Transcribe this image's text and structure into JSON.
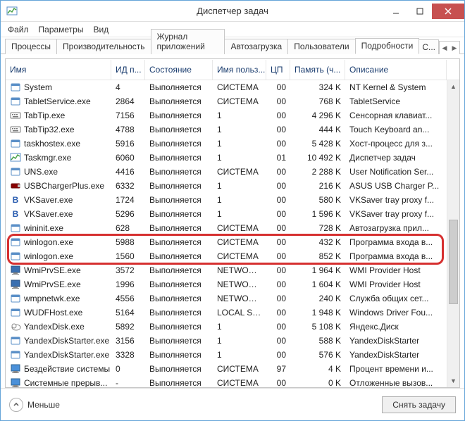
{
  "window": {
    "title": "Диспетчер задач"
  },
  "menu": {
    "file": "Файл",
    "options": "Параметры",
    "view": "Вид"
  },
  "tabs": {
    "items": [
      {
        "label": "Процессы"
      },
      {
        "label": "Производительность"
      },
      {
        "label": "Журнал приложений"
      },
      {
        "label": "Автозагрузка"
      },
      {
        "label": "Пользователи"
      },
      {
        "label": "Подробности"
      },
      {
        "label": "С..."
      }
    ],
    "activeIndex": 5
  },
  "columns": {
    "name": "Имя",
    "pid": "ИД п...",
    "state": "Состояние",
    "user": "Имя польз...",
    "cpu": "ЦП",
    "mem": "Память (ч...",
    "desc": "Описание"
  },
  "rows": [
    {
      "icon": "app",
      "name": "System",
      "pid": "4",
      "state": "Выполняется",
      "user": "СИСТЕМА",
      "cpu": "00",
      "mem": "324 K",
      "desc": "NT Kernel & System"
    },
    {
      "icon": "app",
      "name": "TabletService.exe",
      "pid": "2864",
      "state": "Выполняется",
      "user": "СИСТЕМА",
      "cpu": "00",
      "mem": "768 K",
      "desc": "TabletService"
    },
    {
      "icon": "kbd",
      "name": "TabTip.exe",
      "pid": "7156",
      "state": "Выполняется",
      "user": "1",
      "cpu": "00",
      "mem": "4 296 K",
      "desc": "Сенсорная клавиат..."
    },
    {
      "icon": "kbd",
      "name": "TabTip32.exe",
      "pid": "4788",
      "state": "Выполняется",
      "user": "1",
      "cpu": "00",
      "mem": "444 K",
      "desc": "Touch Keyboard an..."
    },
    {
      "icon": "app",
      "name": "taskhostex.exe",
      "pid": "5916",
      "state": "Выполняется",
      "user": "1",
      "cpu": "00",
      "mem": "5 428 K",
      "desc": "Хост-процесс для з..."
    },
    {
      "icon": "tm",
      "name": "Taskmgr.exe",
      "pid": "6060",
      "state": "Выполняется",
      "user": "1",
      "cpu": "01",
      "mem": "10 492 K",
      "desc": "Диспетчер задач"
    },
    {
      "icon": "app",
      "name": "UNS.exe",
      "pid": "4416",
      "state": "Выполняется",
      "user": "СИСТЕМА",
      "cpu": "00",
      "mem": "2 288 K",
      "desc": "User Notification Ser..."
    },
    {
      "icon": "usb",
      "name": "USBChargerPlus.exe",
      "pid": "6332",
      "state": "Выполняется",
      "user": "1",
      "cpu": "00",
      "mem": "216 K",
      "desc": "ASUS USB Charger P..."
    },
    {
      "icon": "vk",
      "name": "VKSaver.exe",
      "pid": "1724",
      "state": "Выполняется",
      "user": "1",
      "cpu": "00",
      "mem": "580 K",
      "desc": "VKSaver tray proxy f..."
    },
    {
      "icon": "vk",
      "name": "VKSaver.exe",
      "pid": "5296",
      "state": "Выполняется",
      "user": "1",
      "cpu": "00",
      "mem": "1 596 K",
      "desc": "VKSaver tray proxy f..."
    },
    {
      "icon": "app",
      "name": "wininit.exe",
      "pid": "628",
      "state": "Выполняется",
      "user": "СИСТЕМА",
      "cpu": "00",
      "mem": "728 K",
      "desc": "Автозагрузка прил..."
    },
    {
      "icon": "app",
      "name": "winlogon.exe",
      "pid": "5988",
      "state": "Выполняется",
      "user": "СИСТЕМА",
      "cpu": "00",
      "mem": "432 K",
      "desc": "Программа входа в..."
    },
    {
      "icon": "app",
      "name": "winlogon.exe",
      "pid": "1560",
      "state": "Выполняется",
      "user": "СИСТЕМА",
      "cpu": "00",
      "mem": "852 K",
      "desc": "Программа входа в..."
    },
    {
      "icon": "wmi",
      "name": "WmiPrvSE.exe",
      "pid": "3572",
      "state": "Выполняется",
      "user": "NETWORK...",
      "cpu": "00",
      "mem": "1 964 K",
      "desc": "WMI Provider Host"
    },
    {
      "icon": "wmi",
      "name": "WmiPrvSE.exe",
      "pid": "1996",
      "state": "Выполняется",
      "user": "NETWORK...",
      "cpu": "00",
      "mem": "1 604 K",
      "desc": "WMI Provider Host"
    },
    {
      "icon": "app",
      "name": "wmpnetwk.exe",
      "pid": "4556",
      "state": "Выполняется",
      "user": "NETWORK...",
      "cpu": "00",
      "mem": "240 K",
      "desc": "Служба общих сет..."
    },
    {
      "icon": "app",
      "name": "WUDFHost.exe",
      "pid": "5164",
      "state": "Выполняется",
      "user": "LOCAL SE...",
      "cpu": "00",
      "mem": "1 948 K",
      "desc": "Windows Driver Fou..."
    },
    {
      "icon": "yd",
      "name": "YandexDisk.exe",
      "pid": "5892",
      "state": "Выполняется",
      "user": "1",
      "cpu": "00",
      "mem": "5 108 K",
      "desc": "Яндекс.Диск"
    },
    {
      "icon": "app",
      "name": "YandexDiskStarter.exe",
      "pid": "3156",
      "state": "Выполняется",
      "user": "1",
      "cpu": "00",
      "mem": "588 K",
      "desc": "YandexDiskStarter"
    },
    {
      "icon": "app",
      "name": "YandexDiskStarter.exe",
      "pid": "3328",
      "state": "Выполняется",
      "user": "1",
      "cpu": "00",
      "mem": "576 K",
      "desc": "YandexDiskStarter"
    },
    {
      "icon": "sys",
      "name": "Бездействие системы",
      "pid": "0",
      "state": "Выполняется",
      "user": "СИСТЕМА",
      "cpu": "97",
      "mem": "4 K",
      "desc": "Процент времени и..."
    },
    {
      "icon": "sys",
      "name": "Системные прерыв...",
      "pid": "-",
      "state": "Выполняется",
      "user": "СИСТЕМА",
      "cpu": "00",
      "mem": "0 K",
      "desc": "Отложенные вызов..."
    }
  ],
  "highlight": {
    "fromRow": 11,
    "toRow": 12
  },
  "footer": {
    "fewer": "Меньше",
    "endTask": "Снять задачу"
  }
}
